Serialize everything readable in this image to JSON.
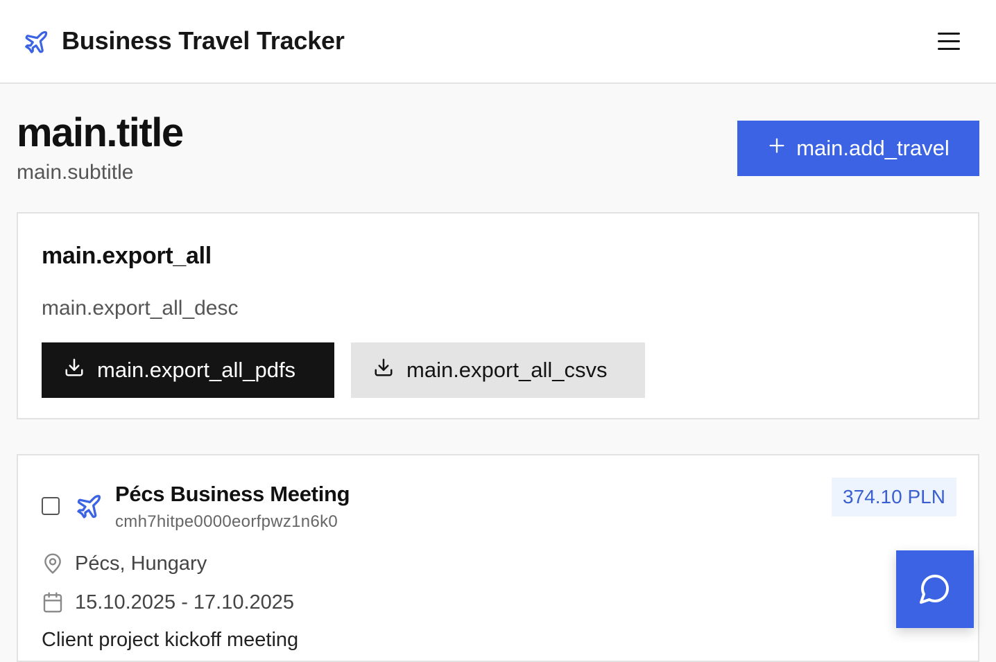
{
  "header": {
    "app_title": "Business Travel Tracker",
    "brand_icon": "plane-icon",
    "menu_icon": "hamburger-menu-icon"
  },
  "main": {
    "title": "main.title",
    "subtitle": "main.subtitle",
    "add_travel_label": "main.add_travel",
    "add_travel_icon": "plus-icon"
  },
  "export": {
    "title": "main.export_all",
    "description": "main.export_all_desc",
    "pdfs_label": "main.export_all_pdfs",
    "csvs_label": "main.export_all_csvs",
    "button_icon": "download-icon"
  },
  "travels": [
    {
      "selected": false,
      "icon": "plane-icon",
      "name": "Pécs Business Meeting",
      "id": "cmh7hitpe0000eorfpwz1n6k0",
      "amount": "374.10 PLN",
      "location": "Pécs, Hungary",
      "dates": "15.10.2025 - 17.10.2025",
      "description": "Client project kickoff meeting"
    }
  ],
  "chat": {
    "icon": "chat-bubble-icon"
  },
  "colors": {
    "accent": "#3b63e3",
    "dark_button": "#141414",
    "light_button": "#e4e4e4",
    "badge_bg": "#eef4fd",
    "badge_text": "#3a5fd0"
  }
}
